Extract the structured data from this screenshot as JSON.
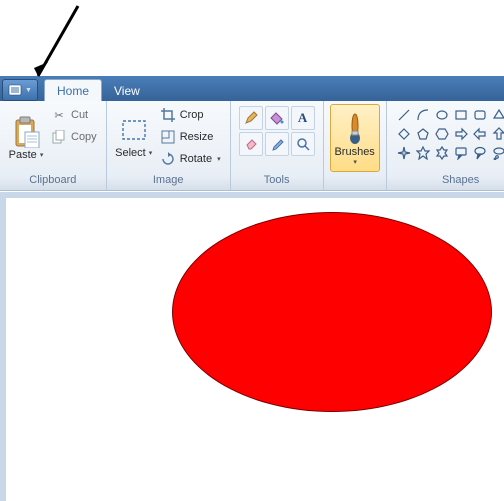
{
  "tabs": {
    "home": "Home",
    "view": "View"
  },
  "clipboard": {
    "label": "Clipboard",
    "paste": "Paste",
    "cut": "Cut",
    "copy": "Copy"
  },
  "image": {
    "label": "Image",
    "select": "Select",
    "crop": "Crop",
    "resize": "Resize",
    "rotate": "Rotate"
  },
  "tools": {
    "label": "Tools"
  },
  "brushes": {
    "label": "Brushes"
  },
  "shapes": {
    "label": "Shapes"
  },
  "icons": {
    "qat": "qat-menu",
    "paste": "clipboard-icon",
    "cut": "scissors-icon",
    "copy": "copy-icon",
    "select": "selection-icon",
    "crop": "crop-icon",
    "resize": "resize-icon",
    "rotate": "rotate-icon",
    "pencil": "pencil-icon",
    "fill": "fill-icon",
    "text": "text-icon",
    "eraser": "eraser-icon",
    "picker": "color-picker-icon",
    "zoom": "magnifier-icon",
    "brush": "brush-icon"
  }
}
